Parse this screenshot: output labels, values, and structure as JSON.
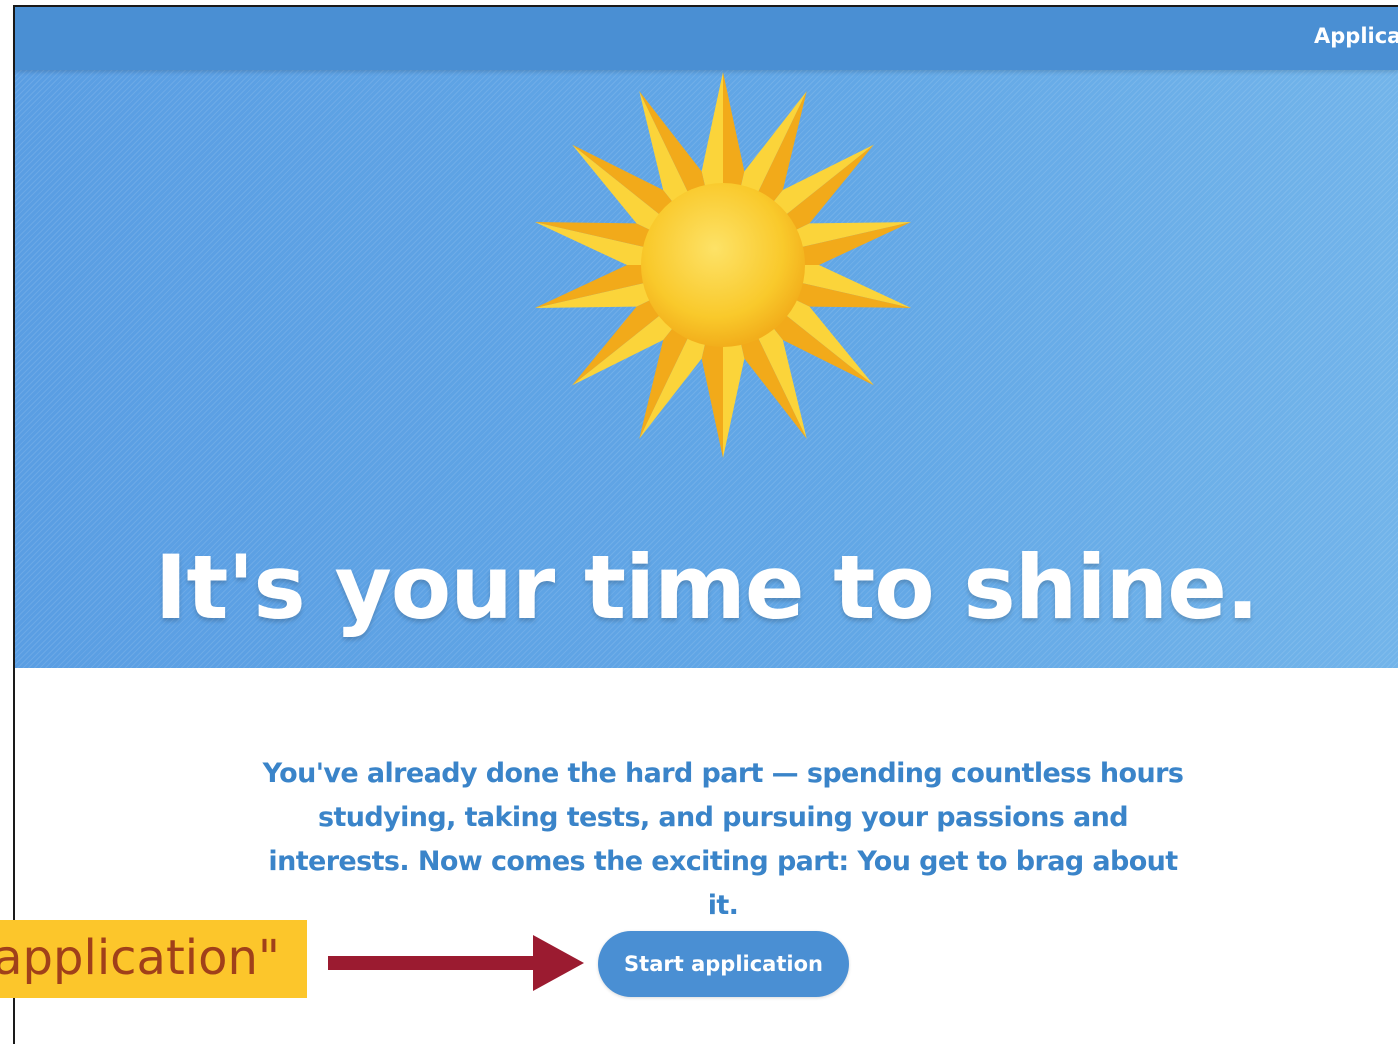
{
  "header": {
    "nav_link": "Applicat"
  },
  "hero": {
    "headline": "It's your time to shine.",
    "sun_icon": "sun-icon",
    "colors": {
      "background": "#5fa3e4",
      "sun_outer": "#f6b31f",
      "sun_inner": "#fbd43a"
    }
  },
  "main": {
    "intro_line_1": "You've already done the hard part — spending countless hours",
    "intro_line_2": "studying, taking tests, and pursuing your passions and",
    "intro_line_3": "interests. Now comes the exciting part: You get to brag about it.",
    "start_button_label": "Start application"
  },
  "annotation": {
    "callout_text": "application\"",
    "arrow_icon": "arrow-right-icon",
    "colors": {
      "callout_bg": "#fcc62b",
      "callout_text": "#a0401a",
      "arrow": "#9b1b30"
    }
  },
  "theme": {
    "primary": "#4a8fd3",
    "text_blue": "#3a84c9"
  }
}
